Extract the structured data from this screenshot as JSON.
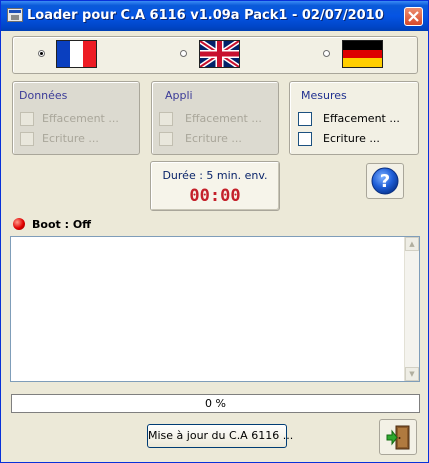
{
  "window": {
    "title": "Loader pour C.A 6116    v1.09a Pack1 - 02/07/2010"
  },
  "languages": [
    {
      "name": "fr-flag-icon",
      "selected": true
    },
    {
      "name": "uk-flag-icon",
      "selected": false
    },
    {
      "name": "de-flag-icon",
      "selected": false
    }
  ],
  "groups": {
    "donnees": {
      "title": "Données",
      "erase": "Effacement ...",
      "write": "Ecriture ...",
      "enabled": false
    },
    "appli": {
      "title": "Appli",
      "erase": "Effacement ...",
      "write": "Ecriture ...",
      "enabled": false
    },
    "mesures": {
      "title": "Mesures",
      "erase": "Effacement ...",
      "write": "Ecriture ...",
      "enabled": true
    }
  },
  "duration": {
    "label": "Durée : 5 min. env.",
    "time": "00:00"
  },
  "boot": {
    "label": "Boot : Off",
    "led_color": "#e00000"
  },
  "log": {
    "text": ""
  },
  "progress": {
    "value": 0,
    "label": "0 %"
  },
  "buttons": {
    "update": "Mise à jour du C.A 6116 ..."
  },
  "icons": {
    "help": "help-icon",
    "exit": "exit-door-icon"
  }
}
